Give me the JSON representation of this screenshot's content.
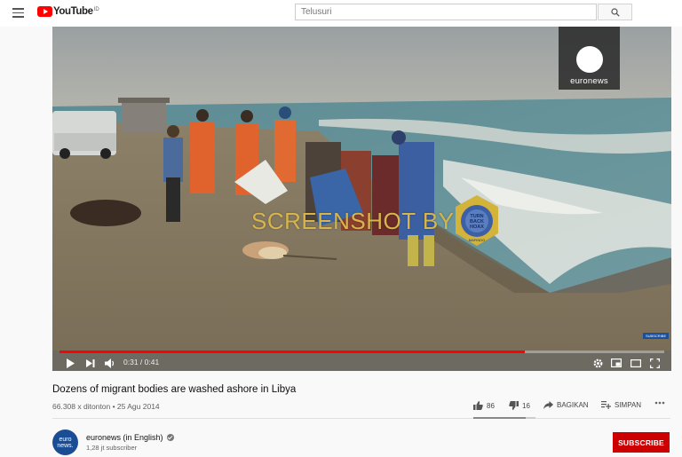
{
  "header": {
    "logo_text": "YouTube",
    "logo_sup": "ID",
    "search_placeholder": "Telusuri",
    "icons": [
      "menu-icon",
      "youtube-logo-icon",
      "search-icon"
    ]
  },
  "video": {
    "watermark": "SCREENSHOT BY",
    "badge_text_top": "TURN",
    "badge_text_mid": "BACK",
    "badge_text_bot": "HOAX",
    "badge_ring_text": "MASYARAKAT ANTI FITNAH INDONESIA",
    "badge_bottom": "MAFINDO",
    "channel_logo_text": "euronews",
    "subscribe_mini": "SUBSCRIBE",
    "time": "0:31 / 0:41",
    "progress": 0.77,
    "colors": {
      "progress": "#ff0000"
    }
  },
  "meta": {
    "title": "Dozens of migrant bodies are washed ashore in Libya",
    "views": "66.308 x ditonton • 25 Agu 2014",
    "likes": "86",
    "dislikes": "16",
    "share_label": "BAGIKAN",
    "save_label": "SIMPAN",
    "like_ratio": 0.84
  },
  "channel": {
    "avatar_text": "euro news.",
    "name": "euronews (in English)",
    "subscribers": "1,28 jt subscriber",
    "subscribe_label": "SUBSCRIBE",
    "colors": {
      "subscribe": "#cc0000"
    }
  }
}
